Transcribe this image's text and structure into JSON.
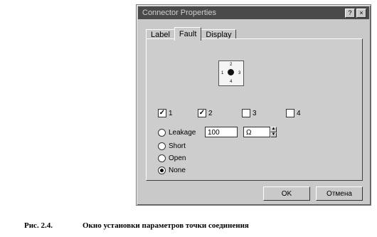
{
  "dialog": {
    "title": "Connector Properties",
    "title_buttons": [
      "?",
      "×"
    ],
    "tabs": [
      "Label",
      "Fault",
      "Display"
    ],
    "active_tab": "Fault",
    "connector_icon": {
      "top": "2",
      "left": "1",
      "right": "3",
      "bottom": "4"
    },
    "checkboxes": [
      {
        "label": "1",
        "checked": true
      },
      {
        "label": "2",
        "checked": true
      },
      {
        "label": "3",
        "checked": false
      },
      {
        "label": "4",
        "checked": false
      }
    ],
    "radios": [
      {
        "label": "Leakage",
        "selected": false
      },
      {
        "label": "Short",
        "selected": false
      },
      {
        "label": "Open",
        "selected": false
      },
      {
        "label": "None",
        "selected": true
      }
    ],
    "leakage_value": "100",
    "leakage_unit": "Ω",
    "ok_label": "OK",
    "cancel_label": "Отмена"
  },
  "caption": {
    "label": "Рис. 2.4.",
    "text": "Окно установки параметров точки соединения"
  }
}
